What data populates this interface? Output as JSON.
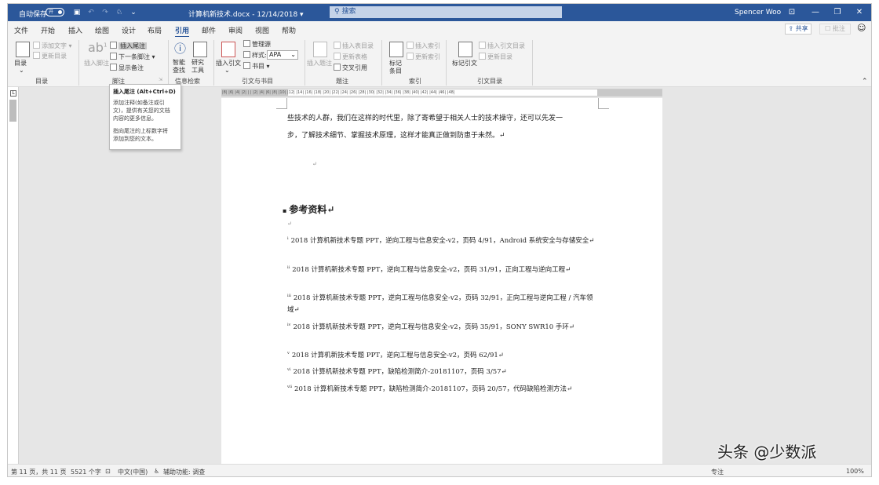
{
  "titlebar": {
    "autosave_label": "自动保存",
    "autosave_state": "开",
    "document_title": "计算机新技术.docx - 12/14/2018 ▾",
    "search_placeholder": "搜索",
    "user_name": "Spencer Woo",
    "minimize": "—",
    "restore": "❐",
    "close": "✕",
    "ribbon_display": "⊡",
    "qa_icons": [
      "save-icon",
      "undo-icon",
      "redo-icon",
      "touch-mode-icon",
      "customize-qa-icon"
    ]
  },
  "menu": {
    "tabs": [
      "文件",
      "开始",
      "插入",
      "绘图",
      "设计",
      "布局",
      "引用",
      "邮件",
      "审阅",
      "视图",
      "帮助"
    ],
    "active_tab": "引用",
    "share_label": "⇪ 共享",
    "comments_label": "☐ 批注",
    "smiley": "☺"
  },
  "ribbon": {
    "toc": {
      "label": "目录",
      "add_text": "添加文字 ▾",
      "update_toc": "更新目录",
      "group_label": "目录"
    },
    "footnotes": {
      "insert_footnote": "插入脚注",
      "insert_endnote": "插入尾注",
      "next_footnote": "下一条脚注 ▾",
      "show_notes": "显示备注",
      "group_label": "脚注",
      "ab_glyph": "ab",
      "ab_sup": "1"
    },
    "research": {
      "smart_lookup": "智能",
      "smart_lookup2": "查找",
      "researcher": "研究",
      "researcher2": "工具",
      "group_label": "信息检索"
    },
    "citations": {
      "insert_citation": "插入引文",
      "manage_sources": "管理源",
      "style_label": "样式:",
      "style_value": "APA",
      "bibliography": "书目 ▾",
      "group_label": "引文与书目"
    },
    "captions": {
      "insert_caption": "插入题注",
      "insert_table_of_figures": "插入表目录",
      "update_table": "更新表格",
      "cross_reference": "交叉引用",
      "group_label": "题注"
    },
    "index": {
      "mark_entry": "标记",
      "mark_entry2": "条目",
      "insert_index": "插入索引",
      "update_index": "更新索引",
      "group_label": "索引"
    },
    "authorities": {
      "mark_citation": "标记引文",
      "insert_toa": "插入引文目录",
      "update_toa": "更新目录",
      "group_label": "引文目录"
    }
  },
  "tooltip": {
    "title": "插入尾注 (Alt+Ctrl+D)",
    "line1": "添加注释(如备注或引",
    "line2": "文)，提供有关您的文档",
    "line3": "内容的更多信息。",
    "line4": "指向尾注的上标数字将",
    "line5": "添加到您的文本。"
  },
  "document": {
    "para_line1": "些技术的人群，我们在这样的时代里，除了寄希望于相关人士的技术操守，还可以先发一",
    "para_line2": "步，了解技术细节、掌握技术原理，这样才能真正做到防患于未然。↵",
    "empty_mark": "↵",
    "heading": "参考资料↵",
    "references": [
      {
        "num": "i",
        "text": "2018 计算机新技术专题 PPT，逆向工程与信息安全-v2，页码 4/91，Android 系统安全与存储安全↵"
      },
      {
        "num": "ii",
        "text": "2018 计算机新技术专题 PPT，逆向工程与信息安全-v2，页码 31/91，正向工程与逆向工程↵"
      },
      {
        "num": "iii",
        "text": "2018 计算机新技术专题 PPT，逆向工程与信息安全-v2，页码 32/91，正向工程与逆向工程 / 汽车领域↵"
      },
      {
        "num": "iv",
        "text": "2018 计算机新技术专题 PPT，逆向工程与信息安全-v2，页码 35/91，SONY SWR10 手环↵"
      },
      {
        "num": "v",
        "text": "2018 计算机新技术专题 PPT，逆向工程与信息安全-v2，页码 62/91↵"
      },
      {
        "num": "vi",
        "text": "2018 计算机新技术专题 PPT，缺陷检测简介-20181107，页码 3/57↵"
      },
      {
        "num": "vii",
        "text": "2018 计算机新技术专题 PPT，缺陷检测简介-20181107，页码 20/57，代码缺陷检测方法↵"
      }
    ]
  },
  "ruler": {
    "h_marks": "|8| |6| |4| |2| | | |2| |4| |6| |8| |10| |12| |14| |16| |18| |20| |22| |24| |26| |28| |30| |32| |34| |36| |38| |40| |42| |44| |46| |48|",
    "tab_stop": "L"
  },
  "statusbar": {
    "page": "第 11 页，共 11 页",
    "words": "5521 个字",
    "language": "中文(中国)",
    "accessibility": "辅助功能: 调查",
    "focus": "专注",
    "zoom": "100%"
  },
  "watermark": "头条 @少数派"
}
